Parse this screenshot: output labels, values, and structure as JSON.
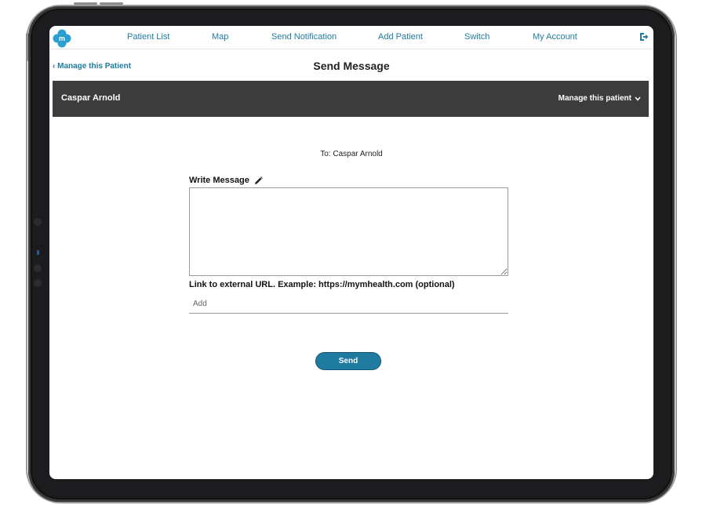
{
  "nav": {
    "items": [
      {
        "label": "Patient List"
      },
      {
        "label": "Map"
      },
      {
        "label": "Send Notification"
      },
      {
        "label": "Add Patient"
      },
      {
        "label": "Switch"
      },
      {
        "label": "My Account"
      }
    ],
    "logo_icon": "m-logo-icon",
    "logout_icon": "sign-out-icon"
  },
  "subheader": {
    "back_label": "Manage this Patient",
    "title": "Send Message"
  },
  "patient_bar": {
    "name": "Caspar Arnold",
    "manage_label": "Manage this patient"
  },
  "form": {
    "to_line": "To: Caspar Arnold",
    "write_label": "Write Message",
    "message_value": "",
    "url_label": "Link to external URL. Example: https://mymhealth.com (optional)",
    "url_placeholder": "Add",
    "send_label": "Send"
  },
  "colors": {
    "accent": "#1f7ba0",
    "bar": "#3c3c3c"
  }
}
